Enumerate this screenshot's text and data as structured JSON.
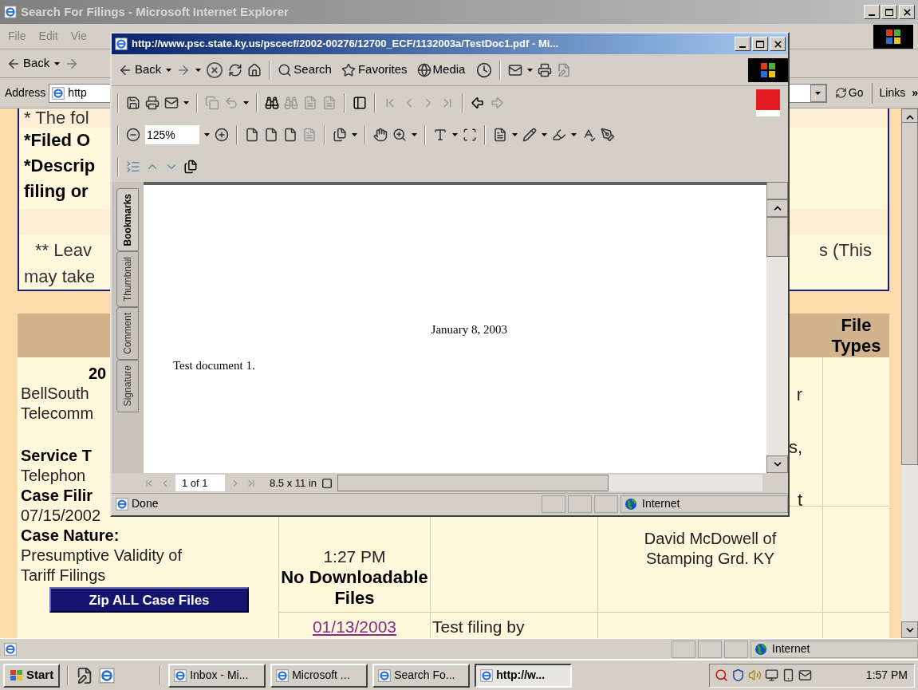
{
  "main_window": {
    "title": "Search For Filings - Microsoft Internet Explorer",
    "menu": [
      "File",
      "Edit",
      "Vie"
    ],
    "back": "Back",
    "address": {
      "label": "Address",
      "value": "http",
      "go": "Go",
      "links": "Links",
      "more": "»"
    },
    "notes": {
      "top_lines": [
        {
          "text": "* The fol",
          "bold": false
        },
        {
          "text": "*Filed O",
          "bold": true
        },
        {
          "text": "*Descrip",
          "bold": true
        },
        {
          "text": "filing or",
          "bold": true
        }
      ],
      "bottom_lines": [
        {
          "text": "** Leav",
          "bold": false
        },
        {
          "text": "may take",
          "bold": false
        }
      ],
      "right_fragment": "s (This"
    },
    "table": {
      "header": "File Types",
      "case": {
        "number": "20",
        "company": [
          "BellSouth",
          "Telecomm"
        ],
        "details": [
          {
            "kind": "label",
            "text": "Service T"
          },
          {
            "kind": "value",
            "text": "Telephon"
          },
          {
            "kind": "label",
            "text": "Case Filir"
          },
          {
            "kind": "value",
            "text": "07/15/2002"
          },
          {
            "kind": "label",
            "text": "Case Nature:"
          },
          {
            "kind": "value",
            "text": "Presumptive Validity of"
          },
          {
            "kind": "value",
            "text": "Tariff Filings"
          }
        ],
        "zip_button": "Zip ALL Case Files"
      },
      "fragments": [
        "r",
        "s,",
        "t"
      ],
      "filing": {
        "time": "1:27 PM",
        "files": "No Downloadable Files",
        "filer": "David McDowell of Stamping Grd. KY"
      },
      "next_filing": {
        "date": "01/13/2003",
        "description": "Test filing by"
      }
    },
    "status_zone": "Internet"
  },
  "popup": {
    "title": "http://www.psc.state.ky.us/pscecf/2002-00276/12700_ECF/1132003a/TestDoc1.pdf - Mi...",
    "back": "Back",
    "search": "Search",
    "favorites": "Favorites",
    "media": "Media",
    "zoom": "125%",
    "side_tabs": [
      {
        "label": "Bookmarks",
        "selected": true
      },
      {
        "label": "Thumbnail",
        "selected": false
      },
      {
        "label": "Comment",
        "selected": false
      },
      {
        "label": "Signature",
        "selected": false
      }
    ],
    "document": {
      "date": "January 8, 2003",
      "body": "Test document 1."
    },
    "page": "1 of 1",
    "page_size": "8.5 x 11 in",
    "status": "Done",
    "zone": "Internet"
  },
  "taskbar": {
    "start": "Start",
    "tasks": [
      {
        "label": "Inbox - Mi...",
        "selected": false
      },
      {
        "label": "Microsoft ...",
        "selected": false
      },
      {
        "label": "Search Fo...",
        "selected": false
      },
      {
        "label": "http://w...",
        "selected": true
      }
    ],
    "clock": "1:57 PM"
  }
}
